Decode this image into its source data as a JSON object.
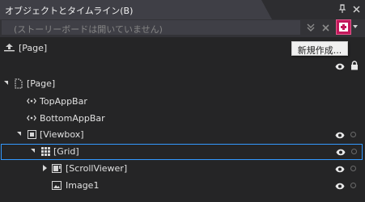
{
  "panel": {
    "title": "オブジェクトとタイムライン(B)",
    "pin_icon": "pin-icon",
    "close_icon": "close-icon"
  },
  "toolbar": {
    "search_text": "(ストーリーボードは開いていません)",
    "collapse_icon": "double-chevron-down-icon",
    "close_storyboard_icon": "close-icon",
    "add_storyboard_icon": "plus-icon",
    "dropdown_icon": "chevron-down-icon",
    "accent_color": "#c2185b"
  },
  "scope": {
    "label": "[Page]",
    "icon": "scope-up-icon"
  },
  "tooltip": {
    "text": "新規作成..."
  },
  "tree": {
    "root": {
      "label": "[Page]"
    },
    "items": [
      {
        "label": "TopAppBar"
      },
      {
        "label": "BottomAppBar"
      },
      {
        "label": "[Viewbox]"
      },
      {
        "label": "[Grid]"
      },
      {
        "label": "[ScrollViewer]"
      },
      {
        "label": "Image1"
      }
    ]
  },
  "colors": {
    "background": "#252526",
    "selection_border": "#3399ff"
  }
}
